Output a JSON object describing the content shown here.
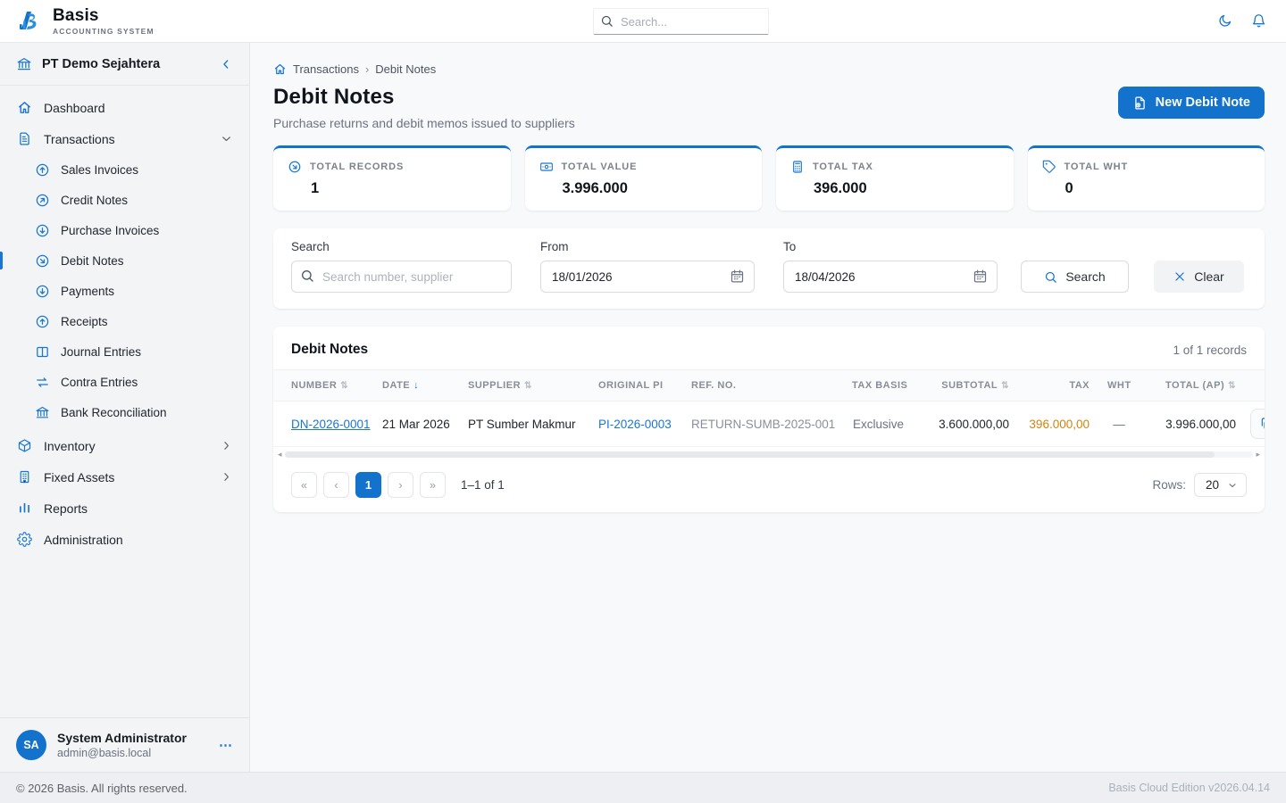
{
  "colors": {
    "primary": "#1272cc",
    "link": "#1976d2",
    "tax_amount": "#d0830e"
  },
  "header": {
    "brand_name": "Basis",
    "brand_tagline": "ACCOUNTING SYSTEM",
    "search_placeholder": "Search..."
  },
  "sidebar": {
    "company": "PT Demo Sejahtera",
    "dashboard": "Dashboard",
    "transactions": "Transactions",
    "sub": {
      "sales_invoices": "Sales Invoices",
      "credit_notes": "Credit Notes",
      "purchase_invoices": "Purchase Invoices",
      "debit_notes": "Debit Notes",
      "payments": "Payments",
      "receipts": "Receipts",
      "journal_entries": "Journal Entries",
      "contra_entries": "Contra Entries",
      "bank_reconciliation": "Bank Reconciliation"
    },
    "inventory": "Inventory",
    "fixed_assets": "Fixed Assets",
    "reports": "Reports",
    "administration": "Administration",
    "profile": {
      "initials": "SA",
      "name": "System Administrator",
      "email": "admin@basis.local",
      "menu_icon": "⋯"
    }
  },
  "breadcrumb": {
    "parent": "Transactions",
    "separator": "›",
    "current": "Debit Notes"
  },
  "page": {
    "title": "Debit Notes",
    "subtitle": "Purchase returns and debit memos issued to suppliers",
    "new_button": "New Debit Note"
  },
  "stats": [
    {
      "label": "TOTAL RECORDS",
      "value": "1",
      "icon": "circle-arrow-down-right-icon"
    },
    {
      "label": "TOTAL VALUE",
      "value": "3.996.000",
      "icon": "banknote-icon"
    },
    {
      "label": "TOTAL TAX",
      "value": "396.000",
      "icon": "tax-calculator-icon"
    },
    {
      "label": "TOTAL WHT",
      "value": "0",
      "icon": "tag-icon"
    }
  ],
  "filters": {
    "search_label": "Search",
    "search_placeholder": "Search number, supplier",
    "from_label": "From",
    "from_value": "18/01/2026",
    "to_label": "To",
    "to_value": "18/04/2026",
    "search_button": "Search",
    "clear_button": "Clear"
  },
  "table": {
    "title": "Debit Notes",
    "records_summary": "1 of 1 records",
    "columns": [
      "NUMBER",
      "DATE",
      "SUPPLIER",
      "ORIGINAL PI",
      "REF. NO.",
      "TAX BASIS",
      "SUBTOTAL",
      "TAX",
      "WHT",
      "TOTAL (AP)"
    ],
    "sort_icons": {
      "both": "⇅",
      "desc": "↓"
    },
    "rows": [
      {
        "number": "DN-2026-0001",
        "date": "21 Mar 2026",
        "supplier": "PT Sumber Makmur",
        "original_pi": "PI-2026-0003",
        "ref_no": "RETURN-SUMB-2025-001",
        "tax_basis": "Exclusive",
        "subtotal": "3.600.000,00",
        "tax": "396.000,00",
        "wht": "—",
        "total_ap": "3.996.000,00"
      }
    ],
    "scrollbar": {
      "left_arrow": "◂",
      "right_arrow": "▸"
    },
    "pagination": {
      "first": "«",
      "prev": "‹",
      "page": "1",
      "next": "›",
      "last": "»",
      "range": "1–1 of 1",
      "rows_label": "Rows:",
      "rows_per_page": "20"
    }
  },
  "footer": {
    "copyright": "© 2026 Basis. All rights reserved.",
    "version": "Basis Cloud Edition v2026.04.14"
  }
}
